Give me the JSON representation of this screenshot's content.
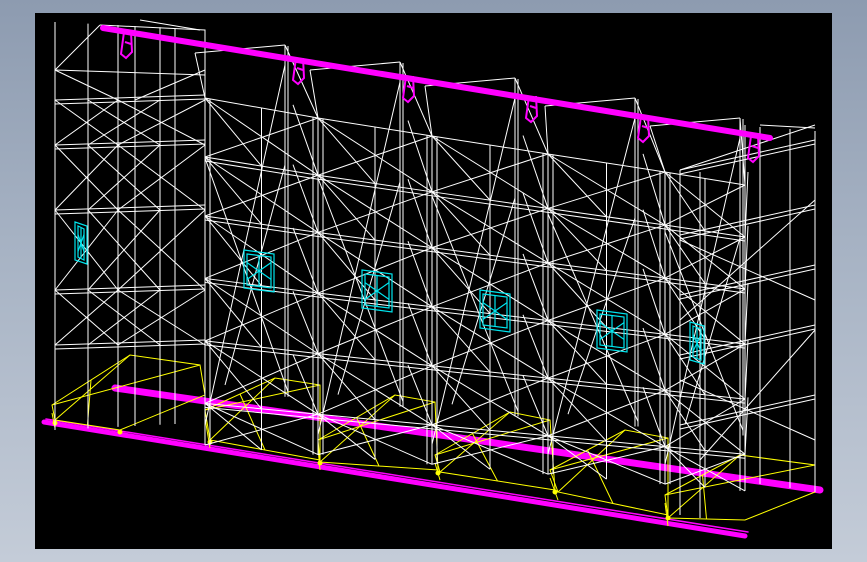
{
  "window": {
    "background_color": "#a7b3c4"
  },
  "viewport": {
    "background_color": "#000000"
  },
  "model": {
    "name": "",
    "colors": {
      "frame": "#ffffff",
      "rail": "#ff00ff",
      "base": "#ffff00",
      "handle": "#00e5ee",
      "hanger": "#ff00ff"
    },
    "layers": [
      "frame-wireframe",
      "top-rail",
      "floor-track",
      "base-carriage",
      "handwheels",
      "hangers"
    ],
    "rack_units": 6,
    "handwheels": 6,
    "hangers": 6
  }
}
